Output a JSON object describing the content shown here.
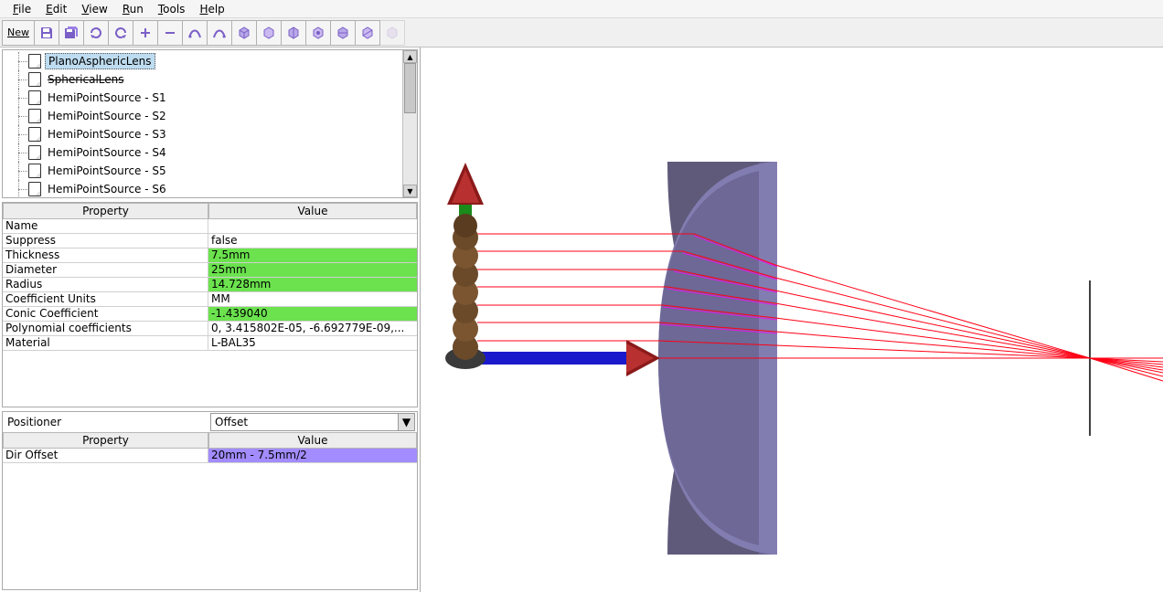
{
  "menu": {
    "items": [
      "File",
      "Edit",
      "View",
      "Run",
      "Tools",
      "Help"
    ]
  },
  "toolbar": {
    "new_label": "New",
    "icons": [
      "new",
      "save",
      "save-all",
      "refresh-ccw",
      "refresh-cw",
      "plus",
      "minus",
      "curve1",
      "curve2",
      "cube1",
      "cube2",
      "cube3",
      "cube4",
      "cube5",
      "cube6",
      "cube7"
    ]
  },
  "tree": {
    "items": [
      {
        "label": "PlanoAsphericLens",
        "selected": true,
        "strike": false
      },
      {
        "label": "SphericalLens",
        "selected": false,
        "strike": true
      },
      {
        "label": "HemiPointSource - S1",
        "selected": false,
        "strike": false
      },
      {
        "label": "HemiPointSource - S2",
        "selected": false,
        "strike": false
      },
      {
        "label": "HemiPointSource - S3",
        "selected": false,
        "strike": false
      },
      {
        "label": "HemiPointSource - S4",
        "selected": false,
        "strike": false
      },
      {
        "label": "HemiPointSource - S5",
        "selected": false,
        "strike": false
      },
      {
        "label": "HemiPointSource - S6",
        "selected": false,
        "strike": false
      }
    ]
  },
  "properties": {
    "headers": {
      "property": "Property",
      "value": "Value"
    },
    "rows": [
      {
        "name": "Name",
        "value": "",
        "hl": ""
      },
      {
        "name": "Suppress",
        "value": "false",
        "hl": ""
      },
      {
        "name": "Thickness",
        "value": "7.5mm",
        "hl": "green"
      },
      {
        "name": "Diameter",
        "value": "25mm",
        "hl": "green"
      },
      {
        "name": "Radius",
        "value": "14.728mm",
        "hl": "green"
      },
      {
        "name": "Coefficient Units",
        "value": "MM",
        "hl": ""
      },
      {
        "name": "Conic Coefficient",
        "value": "-1.439040",
        "hl": "green"
      },
      {
        "name": "Polynomial coefficients",
        "value": "0, 3.415802E-05, -6.692779E-09,...",
        "hl": ""
      },
      {
        "name": "Material",
        "value": "L-BAL35",
        "hl": ""
      }
    ]
  },
  "positioner": {
    "label": "Positioner",
    "selected": "Offset",
    "headers": {
      "property": "Property",
      "value": "Value"
    },
    "rows": [
      {
        "name": "Dir Offset",
        "value": "20mm - 7.5mm/2",
        "hl": "purple"
      }
    ]
  }
}
